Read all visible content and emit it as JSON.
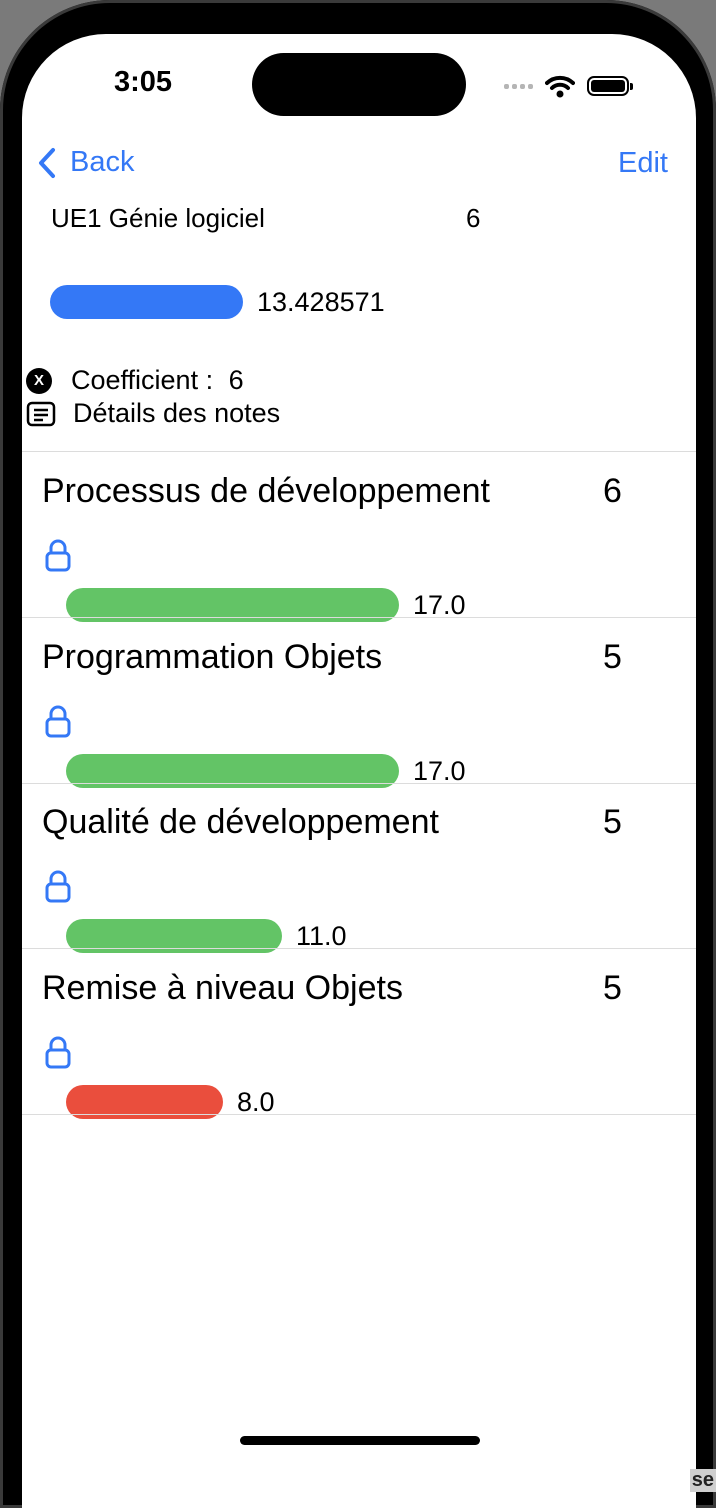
{
  "status_bar": {
    "time": "3:05"
  },
  "nav": {
    "back_label": "Back",
    "edit_label": "Edit"
  },
  "ue": {
    "title": "UE1 Génie logiciel",
    "coefficient": "6",
    "average": "13.428571",
    "average_fraction": 0.6714,
    "bar_color": "#3478f6"
  },
  "info": {
    "coefficient_label": "Coefficient : ",
    "coefficient_value": "6",
    "details_label": "Détails des notes",
    "x_glyph": "X"
  },
  "subjects": [
    {
      "name": "Processus de développement",
      "coefficient": "6",
      "grade": "17.0",
      "fraction": 0.85,
      "color": "#63c466"
    },
    {
      "name": "Programmation Objets",
      "coefficient": "5",
      "grade": "17.0",
      "fraction": 0.85,
      "color": "#63c466"
    },
    {
      "name": "Qualité de développement",
      "coefficient": "5",
      "grade": "11.0",
      "fraction": 0.55,
      "color": "#63c466"
    },
    {
      "name": "Remise à niveau Objets",
      "coefficient": "5",
      "grade": "8.0",
      "fraction": 0.4,
      "color": "#ea4e3d"
    }
  ],
  "corner_text": "se",
  "icons": [
    "chevron-left-icon",
    "wifi-icon",
    "battery-icon",
    "signal-icon",
    "x-circle-icon",
    "notes-icon",
    "lock-icon"
  ]
}
